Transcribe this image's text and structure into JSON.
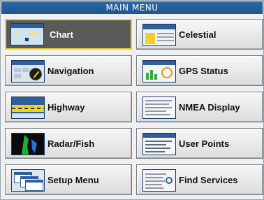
{
  "window": {
    "title": "MAIN MENU"
  },
  "menu": {
    "selected_index": 0,
    "items": [
      {
        "label": "Chart",
        "icon": "chart-thumbnail-icon"
      },
      {
        "label": "Celestial",
        "icon": "celestial-thumbnail-icon"
      },
      {
        "label": "Navigation",
        "icon": "navigation-thumbnail-icon"
      },
      {
        "label": "GPS Status",
        "icon": "gps-status-thumbnail-icon"
      },
      {
        "label": "Highway",
        "icon": "highway-thumbnail-icon"
      },
      {
        "label": "NMEA Display",
        "icon": "nmea-display-thumbnail-icon"
      },
      {
        "label": "Radar/Fish",
        "icon": "radar-fish-thumbnail-icon"
      },
      {
        "label": "User Points",
        "icon": "user-points-thumbnail-icon"
      },
      {
        "label": "Setup Menu",
        "icon": "setup-menu-thumbnail-icon"
      },
      {
        "label": "Find Services",
        "icon": "find-services-thumbnail-icon"
      }
    ]
  },
  "colors": {
    "title_bar": "#1f5490",
    "selected_border": "#f2d21a",
    "selected_fill": "#5a5a5a"
  }
}
